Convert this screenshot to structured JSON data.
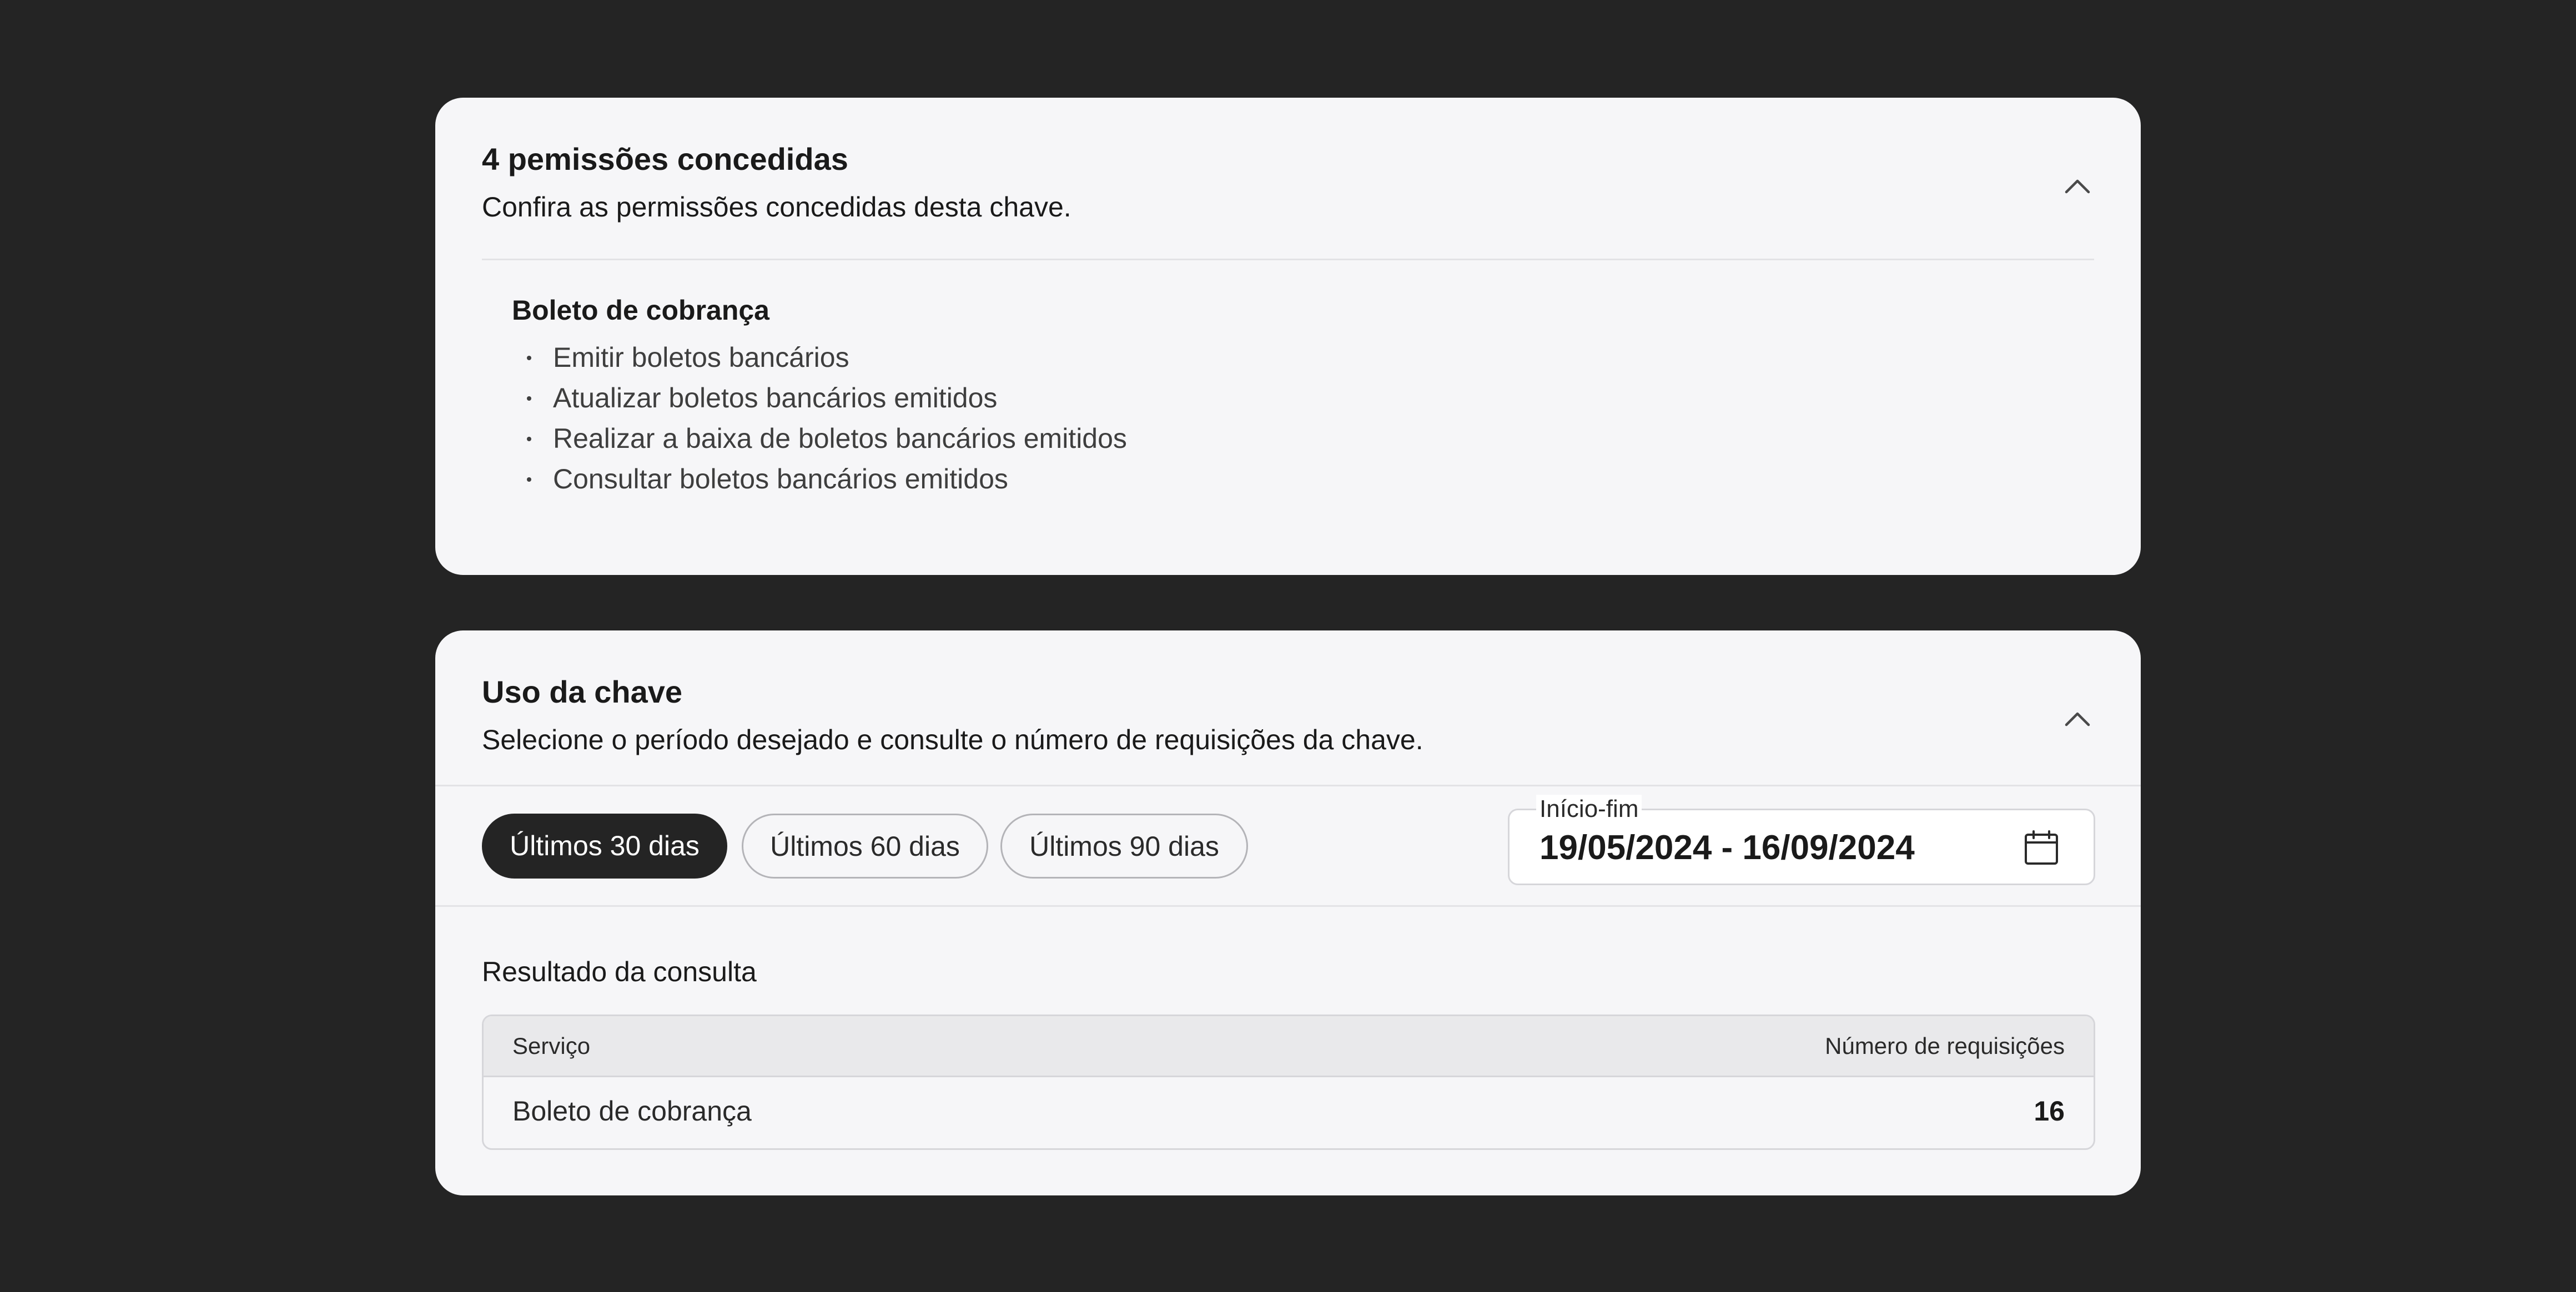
{
  "permissions_card": {
    "title": "4 pemissões concedidas",
    "subtitle": "Confira as permissões concedidas desta chave.",
    "expand_icon": "chevron-up-icon",
    "section_title": "Boleto de cobrança",
    "items": [
      "Emitir boletos bancários",
      "Atualizar boletos bancários emitidos",
      "Realizar a baixa de boletos bancários emitidos",
      "Consultar boletos bancários emitidos"
    ]
  },
  "usage_card": {
    "title": "Uso da chave",
    "subtitle": "Selecione o período desejado e consulte o número de requisições da chave.",
    "expand_icon": "chevron-up-icon",
    "period_chips": [
      {
        "label": "Últimos 30 dias",
        "selected": true
      },
      {
        "label": "Últimos 60 dias",
        "selected": false
      },
      {
        "label": "Últimos 90 dias",
        "selected": false
      }
    ],
    "date_range": {
      "label": "Início-fim",
      "value": "19/05/2024 - 16/09/2024",
      "icon": "calendar-icon"
    },
    "result": {
      "title": "Resultado da consulta",
      "columns": [
        "Serviço",
        "Número de requisições"
      ],
      "rows": [
        {
          "service": "Boleto de cobrança",
          "requests": "16"
        }
      ]
    }
  },
  "colors": {
    "page_background": "#242424",
    "card_background": "#f6f6f8",
    "chip_active": "#242424",
    "table_header": "#e9e9eb"
  }
}
